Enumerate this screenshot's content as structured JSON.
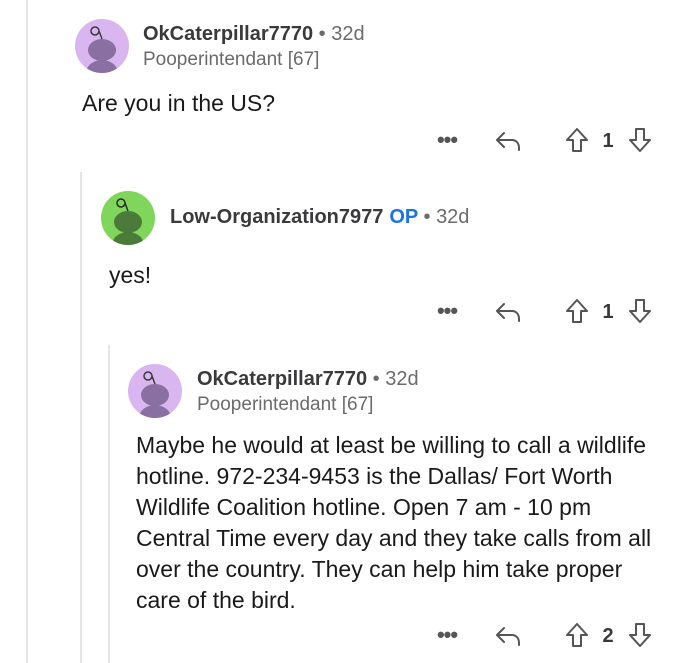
{
  "comments": [
    {
      "username": "OkCaterpillar7770",
      "op_badge": "",
      "age": "32d",
      "flair": "Pooperintendant [67]",
      "body": "Are you in the US?",
      "vote_count": "1",
      "avatar_color": "#d9b6ef"
    },
    {
      "username": "Low-Organization7977",
      "op_badge": "OP",
      "age": "32d",
      "flair": "",
      "body": "yes!",
      "vote_count": "1",
      "avatar_color": "#7fd65a"
    },
    {
      "username": "OkCaterpillar7770",
      "op_badge": "",
      "age": "32d",
      "flair": "Pooperintendant [67]",
      "body": "Maybe he would at least be willing to call a wildlife hotline. 972-234-9453 is the Dallas/ Fort Worth Wildlife Coalition hotline. Open 7 am - 10 pm Central Time every day and they take calls from all over the country. They can help him take proper care of the bird.",
      "vote_count": "2",
      "avatar_color": "#d9b6ef"
    }
  ],
  "icons": {
    "more": "more-options-icon",
    "reply": "reply-arrow-icon",
    "upvote": "upvote-arrow-icon",
    "downvote": "downvote-arrow-icon"
  },
  "separator": "•",
  "more_glyph": "•••"
}
